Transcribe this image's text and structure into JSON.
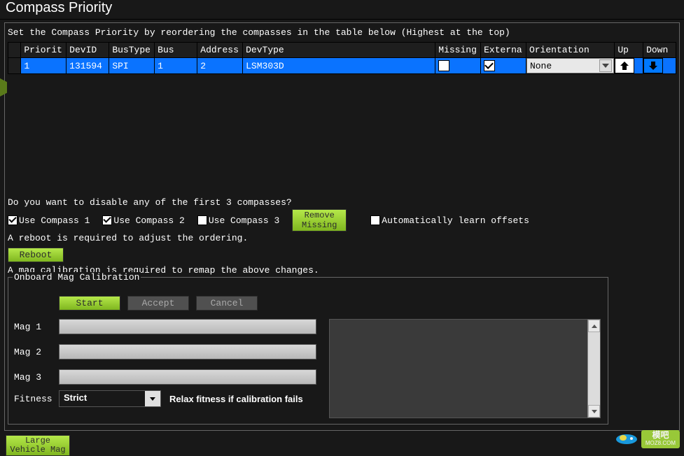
{
  "title": "Compass Priority",
  "instruction": "Set the Compass Priority by reordering the compasses in the table below (Highest at the top)",
  "table": {
    "headers": {
      "priority": "Priorit",
      "devid": "DevID",
      "bustype": "BusType",
      "bus": "Bus",
      "address": "Address",
      "devtype": "DevType",
      "missing": "Missing",
      "external": "Externa",
      "orientation": "Orientation",
      "up": "Up",
      "down": "Down"
    },
    "row": {
      "priority": "1",
      "devid": "131594",
      "bustype": "SPI",
      "bus": "1",
      "address": "2",
      "devtype": "LSM303D",
      "missing_checked": false,
      "external_checked": true,
      "orientation": "None"
    }
  },
  "disable_question": "Do you want to disable any of the first 3 compasses?",
  "checkboxes": {
    "use1": "Use Compass 1",
    "use2": "Use Compass 2",
    "use3": "Use Compass 3",
    "auto_learn": "Automatically learn offsets"
  },
  "buttons": {
    "remove_missing": "Remove\nMissing",
    "reboot": "Reboot",
    "start": "Start",
    "accept": "Accept",
    "cancel": "Cancel",
    "large_vehicle_mag": "Large\nVehicle Mag"
  },
  "reboot_note": "A reboot is required to adjust the ordering.",
  "mag_note": "A mag calibration is required to remap the above changes.",
  "fieldset_label": "Onboard Mag Calibration",
  "mag_labels": {
    "m1": "Mag 1",
    "m2": "Mag 2",
    "m3": "Mag 3",
    "fitness": "Fitness"
  },
  "fitness_value": "Strict",
  "relax_label": "Relax fitness if calibration fails",
  "watermark": {
    "name": "模吧",
    "sub": "MOZ8.COM"
  }
}
